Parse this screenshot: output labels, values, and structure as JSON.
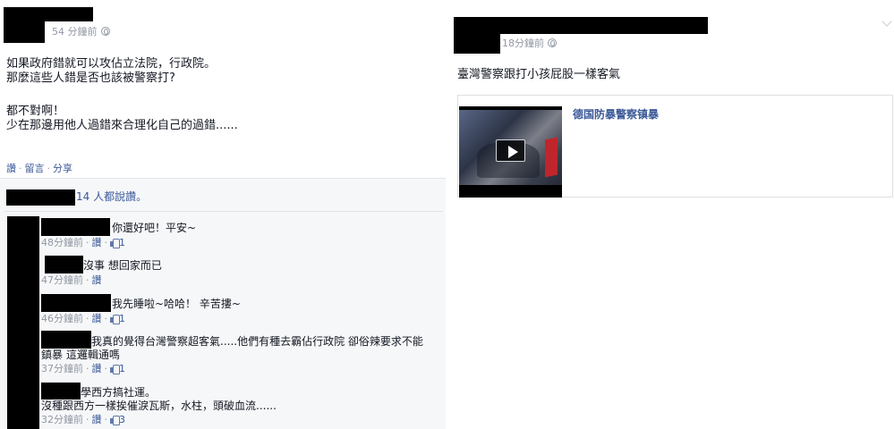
{
  "left_post": {
    "timestamp": "54 分鐘前",
    "text_lines": [
      "如果政府錯就可以攻佔立法院，行政院。",
      "那麼這些人錯是否也該被警察打?",
      "",
      "都不對啊！",
      "少在那邊用他人過錯來合理化自己的過錯......"
    ],
    "actions": {
      "like": "讚",
      "comment": "留言",
      "share": "分享"
    },
    "likes_summary": "14 人都說讚。",
    "comments": [
      {
        "text": "你還好吧！平安~",
        "time": "48分鐘前",
        "like": "讚",
        "likes": "1"
      },
      {
        "text": "沒事 想回家而已",
        "time": "47分鐘前",
        "like": "讚",
        "likes": ""
      },
      {
        "text": "我先睡啦~哈哈！ 辛苦摟~",
        "time": "46分鐘前",
        "like": "讚",
        "likes": "1"
      },
      {
        "text_line1": "我真的覺得台灣警察超客氣.....他們有種去霸佔行政院 卻俗辣要求不能",
        "text_line2": "鎮暴 這邏輯通嗎",
        "time": "37分鐘前",
        "like": "讚",
        "likes": "1"
      },
      {
        "text_line1": "學西方搞社運。",
        "text_line2": "沒種跟西方一樣挨催淚瓦斯，水柱，頭破血流......",
        "time": "32分鐘前",
        "like": "讚",
        "likes": "3"
      }
    ]
  },
  "right_post": {
    "timestamp": "18分鐘前",
    "text": "臺灣警察跟打小孩屁股一樣客氣",
    "share_card": {
      "title": "德国防暴警察镇暴"
    }
  },
  "icons": {
    "audience": "globe-icon",
    "like": "thumbs-up-icon",
    "video": "play-icon",
    "options": "chevron-down-icon"
  },
  "colors": {
    "link": "#3b5998",
    "meta": "#9197a3",
    "text": "#141823",
    "redacted": "#000000"
  }
}
